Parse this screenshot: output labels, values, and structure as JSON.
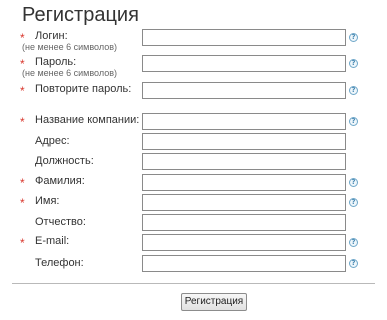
{
  "form": {
    "title": "Регистрация",
    "fields": [
      {
        "label": "Логин:",
        "hint": "(не менее 6 символов)",
        "required": true,
        "value": ""
      },
      {
        "label": "Пароль:",
        "hint": "(не менее 6 символов)",
        "required": true,
        "value": ""
      },
      {
        "label": "Повторите пароль:",
        "required": true,
        "value": ""
      },
      {
        "label": "Название компании:",
        "required": true,
        "value": ""
      },
      {
        "label": "Адрес:",
        "required": false,
        "value": ""
      },
      {
        "label": "Должность:",
        "required": false,
        "value": ""
      },
      {
        "label": "Фамилия:",
        "required": true,
        "value": ""
      },
      {
        "label": "Имя:",
        "required": true,
        "value": ""
      },
      {
        "label": "Отчество:",
        "required": false,
        "value": ""
      },
      {
        "label": "E-mail:",
        "required": true,
        "value": ""
      },
      {
        "label": "Телефон:",
        "required": false,
        "value": ""
      }
    ],
    "required_mark": "*",
    "help_icon_glyph": "?",
    "submit_label": "Регистрация"
  },
  "colors": {
    "required_star": "#d9382e",
    "help_icon": "#4a8ab3",
    "field_border": "#8a8a8a"
  },
  "icons": {
    "help": "question-circle-icon"
  }
}
